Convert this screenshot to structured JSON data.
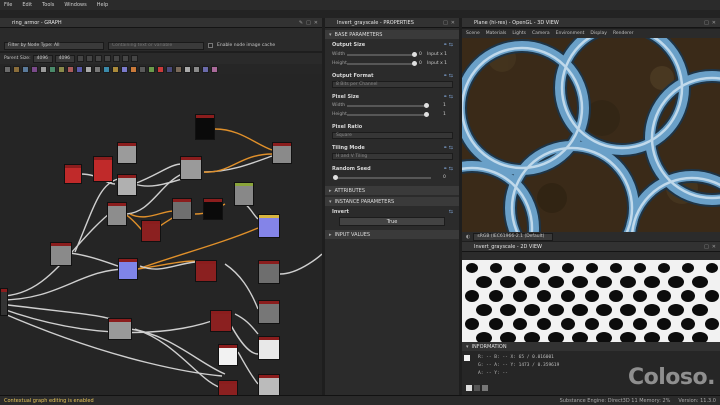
{
  "menubar": {
    "items": [
      "File",
      "Edit",
      "Tools",
      "Windows",
      "Help"
    ]
  },
  "graph": {
    "title": "ring_armor - GRAPH",
    "filter_label": "Filter by Node Type: All",
    "search_placeholder": "Containing text or variable",
    "cache_label": "Enable node image cache",
    "parent_size_label": "Parent Size:",
    "size_values": [
      "4096",
      "4096"
    ]
  },
  "properties": {
    "title": "Invert_grayscale - PROPERTIES",
    "base_params_header": "BASE PARAMETERS",
    "output_size": {
      "label": "Output Size",
      "width_label": "Width",
      "height_label": "Height",
      "width_value": "0",
      "height_value": "0",
      "width_suffix": "Input x 1",
      "height_suffix": "Input x 1"
    },
    "output_format": {
      "label": "Output Format",
      "value": "8 Bits per Channel"
    },
    "pixel_size": {
      "label": "Pixel Size",
      "width_label": "Width",
      "height_label": "Height",
      "width_value": "1",
      "height_value": "1"
    },
    "pixel_ratio": {
      "label": "Pixel Ratio",
      "value": "Square"
    },
    "tiling_mode": {
      "label": "Tiling Mode",
      "value": "H and V Tiling"
    },
    "random_seed": {
      "label": "Random Seed",
      "value": "0"
    },
    "attributes_header": "ATTRIBUTES",
    "instance_params_header": "INSTANCE PARAMETERS",
    "invert": {
      "label": "Invert",
      "value": "True"
    },
    "input_values_header": "INPUT VALUES"
  },
  "view3d": {
    "title": "Plane (hi-res) - OpenGL - 3D VIEW",
    "menu": [
      "Scene",
      "Materials",
      "Lights",
      "Camera",
      "Environment",
      "Display",
      "Renderer"
    ],
    "colorspace": "sRGB (IEC61966-2.1 (Default)"
  },
  "view2d": {
    "title": "Invert_grayscale - 2D VIEW"
  },
  "info": {
    "title": "INFORMATION",
    "lines": [
      "R: --    B: --    X: 65 / 0.016001",
      "G: --    A: --    Y: 1473 / 0.359619",
      "A: --    Y: --"
    ]
  },
  "watermark": "Coloso.",
  "status": {
    "message": "Contextual graph editing is enabled",
    "engine": "Substance Engine: Direct3D 11  Memory: 2%",
    "version": "Version: 11.3.0"
  },
  "colors": {
    "node_header_red": "#8b1d1d",
    "wire_grey": "#cfcfcf",
    "wire_orange": "#e0902a",
    "chain_blue": "#6aa0c8"
  }
}
